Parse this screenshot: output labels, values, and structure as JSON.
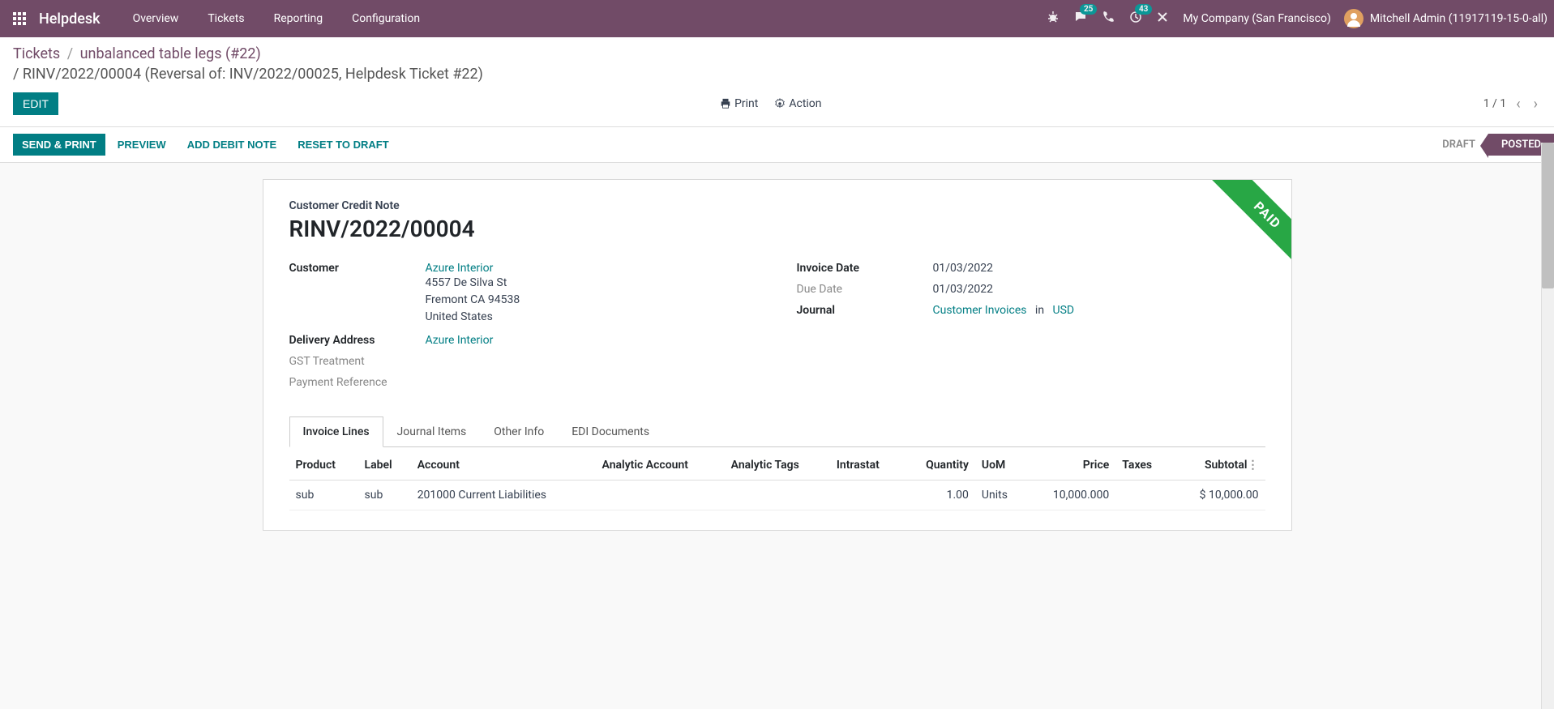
{
  "topbar": {
    "brand": "Helpdesk",
    "nav": [
      "Overview",
      "Tickets",
      "Reporting",
      "Configuration"
    ],
    "messages_badge": "25",
    "activities_badge": "43",
    "company": "My Company (San Francisco)",
    "user": "Mitchell Admin (11917119-15-0-all)"
  },
  "breadcrumb": {
    "root": "Tickets",
    "ticket": "unbalanced table legs (#22)",
    "current": "RINV/2022/00004 (Reversal of: INV/2022/00025, Helpdesk Ticket #22)"
  },
  "controlbar": {
    "edit": "EDIT",
    "print": "Print",
    "action": "Action",
    "pager": "1 / 1"
  },
  "statusbar": {
    "send_print": "SEND & PRINT",
    "preview": "PREVIEW",
    "add_debit": "ADD DEBIT NOTE",
    "reset": "RESET TO DRAFT",
    "draft": "DRAFT",
    "posted": "POSTED"
  },
  "sheet": {
    "ribbon": "PAID",
    "doc_type": "Customer Credit Note",
    "doc_title": "RINV/2022/00004",
    "customer_label": "Customer",
    "customer_name": "Azure Interior",
    "customer_addr1": "4557 De Silva St",
    "customer_addr2": "Fremont CA 94538",
    "customer_addr3": "United States",
    "delivery_label": "Delivery Address",
    "delivery_value": "Azure Interior",
    "gst_label": "GST Treatment",
    "payref_label": "Payment Reference",
    "invoice_date_label": "Invoice Date",
    "invoice_date": "01/03/2022",
    "due_date_label": "Due Date",
    "due_date": "01/03/2022",
    "journal_label": "Journal",
    "journal_value": "Customer Invoices",
    "journal_in": "in",
    "journal_currency": "USD"
  },
  "tabs": [
    "Invoice Lines",
    "Journal Items",
    "Other Info",
    "EDI Documents"
  ],
  "table": {
    "headers": {
      "product": "Product",
      "label": "Label",
      "account": "Account",
      "analytic_account": "Analytic Account",
      "analytic_tags": "Analytic Tags",
      "intrastat": "Intrastat",
      "quantity": "Quantity",
      "uom": "UoM",
      "price": "Price",
      "taxes": "Taxes",
      "subtotal": "Subtotal"
    },
    "rows": [
      {
        "product": "sub",
        "label": "sub",
        "account": "201000 Current Liabilities",
        "analytic_account": "",
        "analytic_tags": "",
        "intrastat": "",
        "quantity": "1.00",
        "uom": "Units",
        "price": "10,000.000",
        "taxes": "",
        "subtotal": "$ 10,000.00"
      }
    ]
  }
}
